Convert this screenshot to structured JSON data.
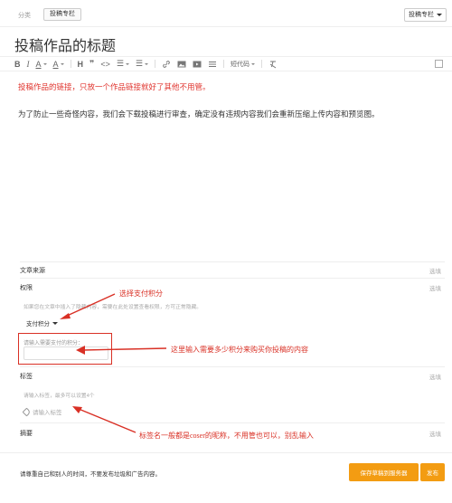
{
  "topbar": {
    "breadcrumb": "分类",
    "tag": "投稿专栏",
    "column_select": "投稿专栏"
  },
  "title": "投稿作品的标题",
  "toolbar": {
    "bold": "B",
    "italic": "I",
    "font_color": "A",
    "highlight": "A",
    "heading": "H",
    "quote": "❞",
    "code": "<>",
    "ul": "☰",
    "ol": "☰",
    "format": "短代码"
  },
  "editor": {
    "line1": "投稿作品的链接，只放一个作品链接就好了其他不用管。",
    "line2": "为了防止一些奇怪内容，我们会下载投稿进行审查，确定没有违规内容我们会重新压缩上传内容和预览图。"
  },
  "panel": {
    "source_label": "文章来源",
    "source_action": "选填",
    "permission_label": "权限",
    "permission_action": "选填",
    "permission_hint": "如果您在文章中插入了隐藏内容，需要在此处设置查看权限，方可正常隐藏。",
    "pay_select": "支付积分",
    "points_label": "请输入需要支付的积分：",
    "points_value": "",
    "tags_label": "标签",
    "tags_action": "选填",
    "tags_hint": "请输入标签，最多可以设置4个",
    "tags_placeholder": "请输入标签",
    "summary_label": "摘要",
    "summary_action": "选填"
  },
  "annotations": {
    "pay": "选择支付积分",
    "points": "这里输入需要多少积分来购买你投稿的内容",
    "tags": "标签名一般都是coser的昵称，不用管也可以，别乱输入"
  },
  "footer": {
    "notice": "请尊重自己和别人的时间，不要发布垃圾和广告内容。",
    "save": "保存草稿到服务器",
    "publish": "发布"
  },
  "colors": {
    "accent": "#f39c12",
    "annotation": "#d93025",
    "hint_red": "#e0342e"
  }
}
